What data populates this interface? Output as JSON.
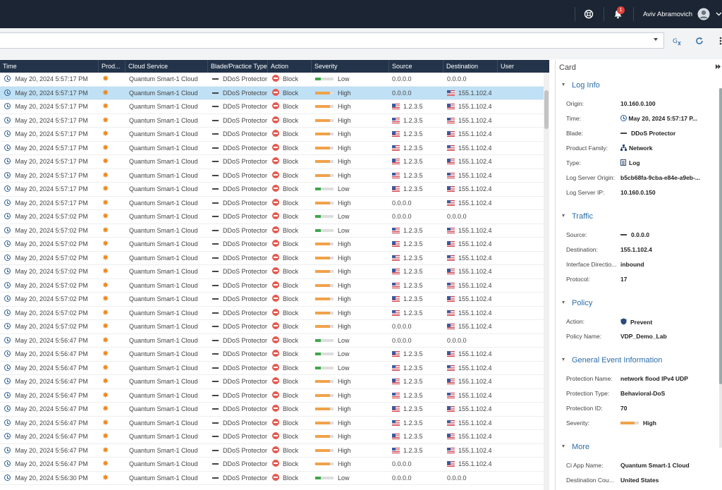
{
  "topbar": {
    "notifications_count": "1",
    "user_name": "Aviv Abramovich"
  },
  "grid": {
    "columns": [
      "Time",
      "Prod...",
      "Cloud Service",
      "Blade/Practice Type",
      "Action",
      "Severity",
      "Source",
      "Destination",
      "User"
    ],
    "rows": [
      {
        "time": "May 20, 2024 5:57:17 PM",
        "service": "Quantum Smart-1 Cloud",
        "blade": "DDoS Protector",
        "action": "Block",
        "severity": "Low",
        "source": "0.0.0.0",
        "dest": "0.0.0.0",
        "src_flag": false,
        "dst_flag": false
      },
      {
        "time": "May 20, 2024 5:57:17 PM",
        "service": "Quantum Smart-1 Cloud",
        "blade": "DDoS Protector",
        "action": "Block",
        "severity": "High",
        "source": "0.0.0.0",
        "dest": "155.1.102.4",
        "src_flag": false,
        "dst_flag": true,
        "selected": true
      },
      {
        "time": "May 20, 2024 5:57:17 PM",
        "service": "Quantum Smart-1 Cloud",
        "blade": "DDoS Protector",
        "action": "Block",
        "severity": "High",
        "source": "1.2.3.5",
        "dest": "155.1.102.4",
        "src_flag": true,
        "dst_flag": true
      },
      {
        "time": "May 20, 2024 5:57:17 PM",
        "service": "Quantum Smart-1 Cloud",
        "blade": "DDoS Protector",
        "action": "Block",
        "severity": "High",
        "source": "1.2.3.5",
        "dest": "155.1.102.4",
        "src_flag": true,
        "dst_flag": true
      },
      {
        "time": "May 20, 2024 5:57:17 PM",
        "service": "Quantum Smart-1 Cloud",
        "blade": "DDoS Protector",
        "action": "Block",
        "severity": "High",
        "source": "1.2.3.5",
        "dest": "155.1.102.4",
        "src_flag": true,
        "dst_flag": true
      },
      {
        "time": "May 20, 2024 5:57:17 PM",
        "service": "Quantum Smart-1 Cloud",
        "blade": "DDoS Protector",
        "action": "Block",
        "severity": "High",
        "source": "1.2.3.5",
        "dest": "155.1.102.4",
        "src_flag": true,
        "dst_flag": true
      },
      {
        "time": "May 20, 2024 5:57:17 PM",
        "service": "Quantum Smart-1 Cloud",
        "blade": "DDoS Protector",
        "action": "Block",
        "severity": "High",
        "source": "1.2.3.5",
        "dest": "155.1.102.4",
        "src_flag": true,
        "dst_flag": true
      },
      {
        "time": "May 20, 2024 5:57:17 PM",
        "service": "Quantum Smart-1 Cloud",
        "blade": "DDoS Protector",
        "action": "Block",
        "severity": "High",
        "source": "1.2.3.5",
        "dest": "155.1.102.4",
        "src_flag": true,
        "dst_flag": true
      },
      {
        "time": "May 20, 2024 5:57:17 PM",
        "service": "Quantum Smart-1 Cloud",
        "blade": "DDoS Protector",
        "action": "Block",
        "severity": "Low",
        "source": "1.2.3.5",
        "dest": "155.1.102.4",
        "src_flag": true,
        "dst_flag": true
      },
      {
        "time": "May 20, 2024 5:57:17 PM",
        "service": "Quantum Smart-1 Cloud",
        "blade": "DDoS Protector",
        "action": "Block",
        "severity": "High",
        "source": "0.0.0.0",
        "dest": "155.1.102.4",
        "src_flag": false,
        "dst_flag": true
      },
      {
        "time": "May 20, 2024 5:57:02 PM",
        "service": "Quantum Smart-1 Cloud",
        "blade": "DDoS Protector",
        "action": "Block",
        "severity": "Low",
        "source": "0.0.0.0",
        "dest": "0.0.0.0",
        "src_flag": false,
        "dst_flag": false
      },
      {
        "time": "May 20, 2024 5:57:02 PM",
        "service": "Quantum Smart-1 Cloud",
        "blade": "DDoS Protector",
        "action": "Block",
        "severity": "Low",
        "source": "1.2.3.5",
        "dest": "155.1.102.4",
        "src_flag": true,
        "dst_flag": true
      },
      {
        "time": "May 20, 2024 5:57:02 PM",
        "service": "Quantum Smart-1 Cloud",
        "blade": "DDoS Protector",
        "action": "Block",
        "severity": "High",
        "source": "1.2.3.5",
        "dest": "155.1.102.4",
        "src_flag": true,
        "dst_flag": true
      },
      {
        "time": "May 20, 2024 5:57:02 PM",
        "service": "Quantum Smart-1 Cloud",
        "blade": "DDoS Protector",
        "action": "Block",
        "severity": "High",
        "source": "1.2.3.5",
        "dest": "155.1.102.4",
        "src_flag": true,
        "dst_flag": true
      },
      {
        "time": "May 20, 2024 5:57:02 PM",
        "service": "Quantum Smart-1 Cloud",
        "blade": "DDoS Protector",
        "action": "Block",
        "severity": "High",
        "source": "1.2.3.5",
        "dest": "155.1.102.4",
        "src_flag": true,
        "dst_flag": true
      },
      {
        "time": "May 20, 2024 5:57:02 PM",
        "service": "Quantum Smart-1 Cloud",
        "blade": "DDoS Protector",
        "action": "Block",
        "severity": "High",
        "source": "1.2.3.5",
        "dest": "155.1.102.4",
        "src_flag": true,
        "dst_flag": true
      },
      {
        "time": "May 20, 2024 5:57:02 PM",
        "service": "Quantum Smart-1 Cloud",
        "blade": "DDoS Protector",
        "action": "Block",
        "severity": "High",
        "source": "1.2.3.5",
        "dest": "155.1.102.4",
        "src_flag": true,
        "dst_flag": true
      },
      {
        "time": "May 20, 2024 5:57:02 PM",
        "service": "Quantum Smart-1 Cloud",
        "blade": "DDoS Protector",
        "action": "Block",
        "severity": "High",
        "source": "1.2.3.5",
        "dest": "155.1.102.4",
        "src_flag": true,
        "dst_flag": true
      },
      {
        "time": "May 20, 2024 5:57:02 PM",
        "service": "Quantum Smart-1 Cloud",
        "blade": "DDoS Protector",
        "action": "Block",
        "severity": "High",
        "source": "0.0.0.0",
        "dest": "155.1.102.4",
        "src_flag": false,
        "dst_flag": true
      },
      {
        "time": "May 20, 2024 5:56:47 PM",
        "service": "Quantum Smart-1 Cloud",
        "blade": "DDoS Protector",
        "action": "Block",
        "severity": "Low",
        "source": "0.0.0.0",
        "dest": "0.0.0.0",
        "src_flag": false,
        "dst_flag": false
      },
      {
        "time": "May 20, 2024 5:56:47 PM",
        "service": "Quantum Smart-1 Cloud",
        "blade": "DDoS Protector",
        "action": "Block",
        "severity": "Low",
        "source": "1.2.3.5",
        "dest": "155.1.102.4",
        "src_flag": true,
        "dst_flag": true
      },
      {
        "time": "May 20, 2024 5:56:47 PM",
        "service": "Quantum Smart-1 Cloud",
        "blade": "DDoS Protector",
        "action": "Block",
        "severity": "Low",
        "source": "1.2.3.5",
        "dest": "155.1.102.4",
        "src_flag": true,
        "dst_flag": true
      },
      {
        "time": "May 20, 2024 5:56:47 PM",
        "service": "Quantum Smart-1 Cloud",
        "blade": "DDoS Protector",
        "action": "Block",
        "severity": "High",
        "source": "1.2.3.5",
        "dest": "155.1.102.4",
        "src_flag": true,
        "dst_flag": true
      },
      {
        "time": "May 20, 2024 5:56:47 PM",
        "service": "Quantum Smart-1 Cloud",
        "blade": "DDoS Protector",
        "action": "Block",
        "severity": "High",
        "source": "1.2.3.5",
        "dest": "155.1.102.4",
        "src_flag": true,
        "dst_flag": true
      },
      {
        "time": "May 20, 2024 5:56:47 PM",
        "service": "Quantum Smart-1 Cloud",
        "blade": "DDoS Protector",
        "action": "Block",
        "severity": "High",
        "source": "1.2.3.5",
        "dest": "155.1.102.4",
        "src_flag": true,
        "dst_flag": true
      },
      {
        "time": "May 20, 2024 5:56:47 PM",
        "service": "Quantum Smart-1 Cloud",
        "blade": "DDoS Protector",
        "action": "Block",
        "severity": "High",
        "source": "1.2.3.5",
        "dest": "155.1.102.4",
        "src_flag": true,
        "dst_flag": true
      },
      {
        "time": "May 20, 2024 5:56:47 PM",
        "service": "Quantum Smart-1 Cloud",
        "blade": "DDoS Protector",
        "action": "Block",
        "severity": "High",
        "source": "1.2.3.5",
        "dest": "155.1.102.4",
        "src_flag": true,
        "dst_flag": true
      },
      {
        "time": "May 20, 2024 5:56:47 PM",
        "service": "Quantum Smart-1 Cloud",
        "blade": "DDoS Protector",
        "action": "Block",
        "severity": "High",
        "source": "1.2.3.5",
        "dest": "155.1.102.4",
        "src_flag": true,
        "dst_flag": true
      },
      {
        "time": "May 20, 2024 5:56:47 PM",
        "service": "Quantum Smart-1 Cloud",
        "blade": "DDoS Protector",
        "action": "Block",
        "severity": "High",
        "source": "0.0.0.0",
        "dest": "155.1.102.4",
        "src_flag": false,
        "dst_flag": true
      },
      {
        "time": "May 20, 2024 5:56:30 PM",
        "service": "Quantum Smart-1 Cloud",
        "blade": "DDoS Protector",
        "action": "Block",
        "severity": "Low",
        "source": "0.0.0.0",
        "dest": "0.0.0.0",
        "src_flag": false,
        "dst_flag": false
      }
    ]
  },
  "colors": {
    "severity_high": "#f0a24a",
    "severity_low": "#3ea84a",
    "block": "#e35a4f",
    "accent": "#2c6da8",
    "topbar": "#1b2533"
  },
  "card": {
    "title": "Card",
    "log_info": {
      "heading": "Log Info",
      "origin_label": "Origin:",
      "origin": "10.160.0.100",
      "time_label": "Time:",
      "time": "May 20, 2024 5:57:17 P...",
      "blade_label": "Blade:",
      "blade": "DDoS Protector",
      "family_label": "Product Family:",
      "family": "Network",
      "type_label": "Type:",
      "type": "Log",
      "server_origin_label": "Log Server Origin:",
      "server_origin": "b5cb68fa-9cba-e84e-a9eb-...",
      "server_ip_label": "Log Server IP:",
      "server_ip": "10.160.0.150"
    },
    "traffic": {
      "heading": "Traffic",
      "source_label": "Source:",
      "source": "0.0.0.0",
      "dest_label": "Destination:",
      "dest": "155.1.102.4",
      "iface_label": "Interface Directio...",
      "iface": "inbound",
      "proto_label": "Protocol:",
      "proto": "17"
    },
    "policy": {
      "heading": "Policy",
      "action_label": "Action:",
      "action": "Prevent",
      "name_label": "Policy Name:",
      "name": "VDP_Demo_Lab"
    },
    "general": {
      "heading": "General Event Information",
      "pname_label": "Protection Name:",
      "pname": "network flood IPv4 UDP",
      "ptype_label": "Protection Type:",
      "ptype": "Behavioral-DoS",
      "pid_label": "Protection ID:",
      "pid": "70",
      "sev_label": "Severity:",
      "sev": "High"
    },
    "more": {
      "heading": "More",
      "app_label": "Ci App Name:",
      "app": "Quantum Smart-1 Cloud",
      "country_label": "Destination Cou...",
      "country": "United States"
    }
  }
}
